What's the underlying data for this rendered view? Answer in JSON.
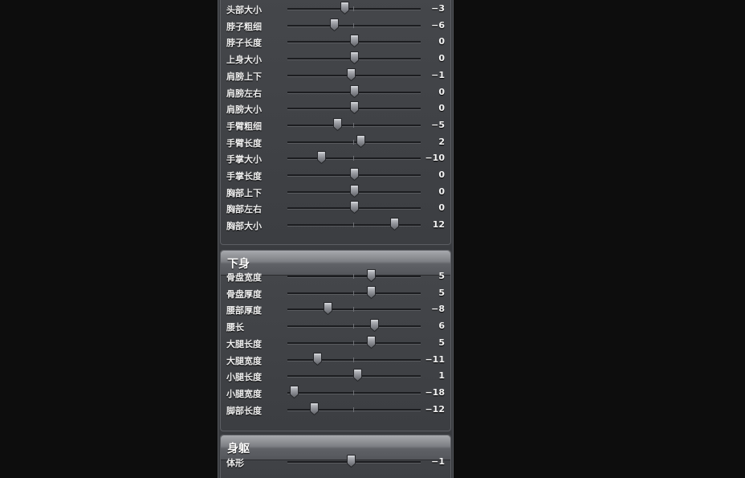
{
  "slider_min": -20,
  "slider_max": 20,
  "sections": [
    {
      "title": "",
      "rows": [
        {
          "label": "头部大小",
          "value": -3
        },
        {
          "label": "脖子粗细",
          "value": -6
        },
        {
          "label": "脖子长度",
          "value": 0
        },
        {
          "label": "上身大小",
          "value": 0
        },
        {
          "label": "肩膀上下",
          "value": -1
        },
        {
          "label": "肩膀左右",
          "value": 0
        },
        {
          "label": "肩膀大小",
          "value": 0
        },
        {
          "label": "手臂粗细",
          "value": -5
        },
        {
          "label": "手臂长度",
          "value": 2
        },
        {
          "label": "手掌大小",
          "value": -10
        },
        {
          "label": "手掌长度",
          "value": 0
        },
        {
          "label": "胸部上下",
          "value": 0
        },
        {
          "label": "胸部左右",
          "value": 0
        },
        {
          "label": "胸部大小",
          "value": 12
        }
      ]
    },
    {
      "title": "下身",
      "rows": [
        {
          "label": "骨盘宽度",
          "value": 5
        },
        {
          "label": "骨盘厚度",
          "value": 5
        },
        {
          "label": "腰部厚度",
          "value": -8
        },
        {
          "label": "腰长",
          "value": 6
        },
        {
          "label": "大腿长度",
          "value": 5
        },
        {
          "label": "大腿宽度",
          "value": -11
        },
        {
          "label": "小腿长度",
          "value": 1
        },
        {
          "label": "小腿宽度",
          "value": -18
        },
        {
          "label": "脚部长度",
          "value": -12
        }
      ]
    },
    {
      "title": "身躯",
      "rows": [
        {
          "label": "体形",
          "value": -1
        }
      ]
    }
  ]
}
